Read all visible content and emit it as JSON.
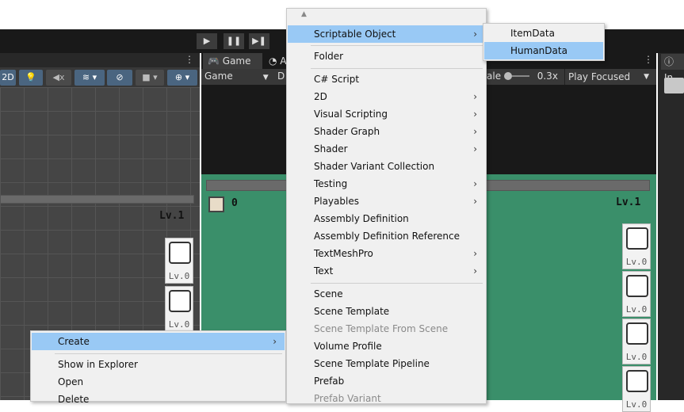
{
  "toolbar": {
    "play": "▶",
    "pause": "❚❚",
    "step": "▶❚"
  },
  "scene": {
    "mode_2d": "2D",
    "level": "Lv.1",
    "slots": [
      "Lv.0",
      "Lv.0"
    ]
  },
  "game": {
    "tab_game": "Game",
    "tab_animation": "A",
    "display": "Game",
    "display2": "D",
    "scale_label": "ale",
    "scale_value": "0.3x",
    "play_mode": "Play Focused",
    "score": "0",
    "level": "Lv.1",
    "slots": [
      "Lv.0",
      "Lv.0",
      "Lv.0",
      "Lv.0"
    ],
    "field_color": "#3a8f6a"
  },
  "inspector": {
    "tab": "In"
  },
  "create_menu": {
    "items": [
      {
        "label": "Scriptable Object",
        "submenu": true,
        "selected": true
      },
      {
        "label": "Folder"
      },
      {
        "label": "C# Script"
      },
      {
        "label": "2D",
        "submenu": true
      },
      {
        "label": "Visual Scripting",
        "submenu": true
      },
      {
        "label": "Shader Graph",
        "submenu": true
      },
      {
        "label": "Shader",
        "submenu": true
      },
      {
        "label": "Shader Variant Collection"
      },
      {
        "label": "Testing",
        "submenu": true
      },
      {
        "label": "Playables",
        "submenu": true
      },
      {
        "label": "Assembly Definition"
      },
      {
        "label": "Assembly Definition Reference"
      },
      {
        "label": "TextMeshPro",
        "submenu": true
      },
      {
        "label": "Text",
        "submenu": true
      },
      {
        "label": "Scene"
      },
      {
        "label": "Scene Template"
      },
      {
        "label": "Scene Template From Scene",
        "disabled": true
      },
      {
        "label": "Volume Profile"
      },
      {
        "label": "Scene Template Pipeline"
      },
      {
        "label": "Prefab"
      },
      {
        "label": "Prefab Variant",
        "disabled": true
      }
    ]
  },
  "scriptable_submenu": {
    "items": [
      "ItemData",
      "HumanData"
    ]
  },
  "project_menu": {
    "items": [
      "Create",
      "Show in Explorer",
      "Open",
      "Delete"
    ]
  },
  "colors": {
    "highlight": "#99c9f5",
    "accent": "#4a6580"
  }
}
